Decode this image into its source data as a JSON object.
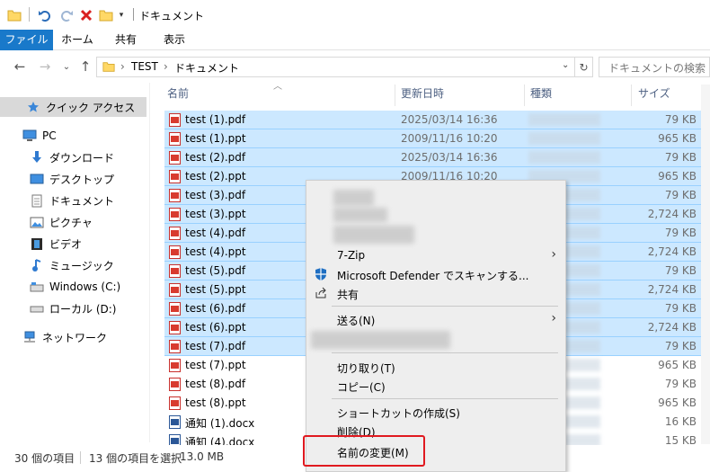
{
  "window": {
    "title": "ドキュメント"
  },
  "ribbon": {
    "tabs": [
      "ファイル",
      "ホーム",
      "共有",
      "表示"
    ]
  },
  "address": {
    "crumbs": [
      "TEST",
      "ドキュメント"
    ],
    "search_placeholder": "ドキュメントの検索"
  },
  "nav": {
    "quick_access": "クイック アクセス",
    "pc": "PC",
    "items": [
      "ダウンロード",
      "デスクトップ",
      "ドキュメント",
      "ピクチャ",
      "ビデオ",
      "ミュージック",
      "Windows (C:)",
      "ローカル (D:)"
    ],
    "network": "ネットワーク"
  },
  "columns": {
    "name": "名前",
    "modified": "更新日時",
    "type": "種類",
    "size": "サイズ"
  },
  "files": [
    {
      "name": "test (1).pdf",
      "date": "2025/03/14 16:36",
      "size": "79 KB",
      "kind": "pdf",
      "selected": true
    },
    {
      "name": "test (1).ppt",
      "date": "2009/11/16 10:20",
      "size": "965 KB",
      "kind": "ppt",
      "selected": true
    },
    {
      "name": "test (2).pdf",
      "date": "2025/03/14 16:36",
      "size": "79 KB",
      "kind": "pdf",
      "selected": true
    },
    {
      "name": "test (2).ppt",
      "date": "2009/11/16 10:20",
      "size": "965 KB",
      "kind": "ppt",
      "selected": true
    },
    {
      "name": "test (3).pdf",
      "date": "",
      "size": "79 KB",
      "kind": "pdf",
      "selected": true
    },
    {
      "name": "test (3).ppt",
      "date": "",
      "size": "2,724 KB",
      "kind": "ppt",
      "selected": true
    },
    {
      "name": "test (4).pdf",
      "date": "",
      "size": "79 KB",
      "kind": "pdf",
      "selected": true
    },
    {
      "name": "test (4).ppt",
      "date": "",
      "size": "2,724 KB",
      "kind": "ppt",
      "selected": true
    },
    {
      "name": "test (5).pdf",
      "date": "",
      "size": "79 KB",
      "kind": "pdf",
      "selected": true
    },
    {
      "name": "test (5).ppt",
      "date": "",
      "size": "2,724 KB",
      "kind": "ppt",
      "selected": true
    },
    {
      "name": "test (6).pdf",
      "date": "",
      "size": "79 KB",
      "kind": "pdf",
      "selected": true
    },
    {
      "name": "test (6).ppt",
      "date": "",
      "size": "2,724 KB",
      "kind": "ppt",
      "selected": true
    },
    {
      "name": "test (7).pdf",
      "date": "",
      "size": "79 KB",
      "kind": "pdf",
      "selected": true
    },
    {
      "name": "test (7).ppt",
      "date": "",
      "size": "965 KB",
      "kind": "ppt",
      "selected": false
    },
    {
      "name": "test (8).pdf",
      "date": "",
      "size": "79 KB",
      "kind": "pdf",
      "selected": false
    },
    {
      "name": "test (8).ppt",
      "date": "",
      "size": "965 KB",
      "kind": "ppt",
      "selected": false
    },
    {
      "name": "通知 (1).docx",
      "date": "",
      "size": "16 KB",
      "kind": "docx",
      "selected": false
    },
    {
      "name": "通知 (4).docx",
      "date": "",
      "size": "15 KB",
      "kind": "docx",
      "selected": false
    }
  ],
  "status": {
    "count": "30 個の項目",
    "selection": "13 個の項目を選択",
    "sel_size": "13.0 MB"
  },
  "context_menu": {
    "zip": "7-Zip",
    "defender": "Microsoft Defender でスキャンする...",
    "share": "共有",
    "send_to": "送る(N)",
    "cut": "切り取り(T)",
    "copy": "コピー(C)",
    "shortcut": "ショートカットの作成(S)",
    "delete": "削除(D)",
    "rename": "名前の変更(M)"
  },
  "colors": {
    "accent": "#1979ca",
    "selection": "#cce8ff",
    "highlight": "#e0191f"
  }
}
